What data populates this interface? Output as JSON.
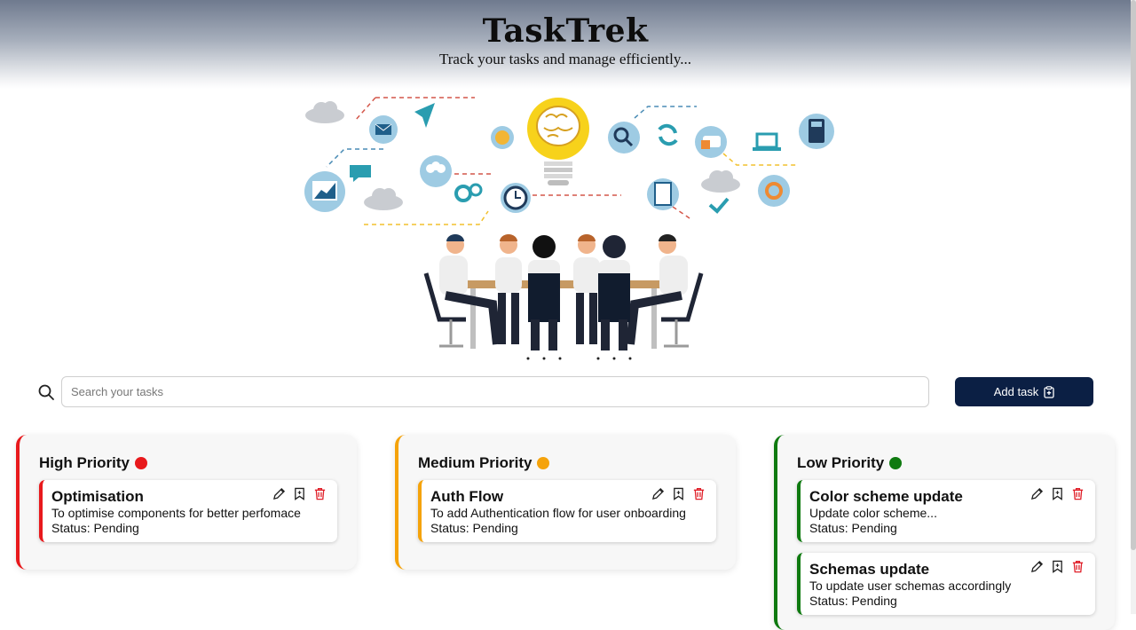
{
  "header": {
    "title": "TaskTrek",
    "subtitle": "Track your tasks and manage efficiently..."
  },
  "hero": {
    "image_name": "team-meeting-brainstorm-illustration"
  },
  "search": {
    "placeholder": "Search your tasks",
    "value": ""
  },
  "toolbar": {
    "add_label": "Add task",
    "add_icon": "clipboard-plus-icon"
  },
  "colors": {
    "high": "#e8191c",
    "medium": "#f5a30b",
    "low": "#0f7a10",
    "button": "#0b1f44",
    "delete": "#e0202a"
  },
  "columns": [
    {
      "title": "High Priority",
      "tasks": [
        {
          "title": "Optimisation",
          "description": "To optimise components for better perfomace",
          "status": "Status: Pending"
        }
      ]
    },
    {
      "title": "Medium Priority",
      "tasks": [
        {
          "title": "Auth Flow",
          "description": "To add Authentication flow for user onboarding",
          "status": "Status: Pending"
        }
      ]
    },
    {
      "title": "Low Priority",
      "tasks": [
        {
          "title": "Color scheme update",
          "description": "Update color scheme...",
          "status": "Status: Pending"
        },
        {
          "title": "Schemas update",
          "description": "To update user schemas accordingly",
          "status": "Status: Pending"
        }
      ]
    }
  ]
}
